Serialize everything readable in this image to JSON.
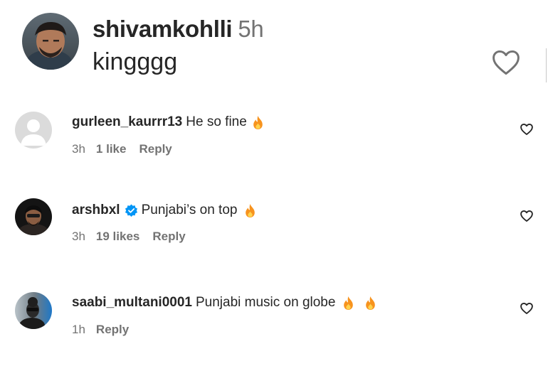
{
  "main_comment": {
    "username": "shivamkohlli",
    "time": "5h",
    "text": "kingggg"
  },
  "replies": [
    {
      "username": "gurleen_kaurrr13",
      "verified": false,
      "text": "He so fine",
      "emoji": [
        "fire-icon"
      ],
      "time": "3h",
      "likes": "1 like",
      "reply_label": "Reply"
    },
    {
      "username": "arshbxl",
      "verified": true,
      "text": "Punjabi’s on top",
      "emoji": [
        "fire-icon"
      ],
      "time": "3h",
      "likes": "19 likes",
      "reply_label": "Reply"
    },
    {
      "username": "saabi_multani0001",
      "verified": false,
      "text": "Punjabi music on globe",
      "emoji": [
        "fire-icon",
        "fire-icon"
      ],
      "time": "1h",
      "likes": "",
      "reply_label": "Reply"
    }
  ],
  "colors": {
    "text_primary": "#262626",
    "text_secondary": "#737373",
    "verified_blue": "#0095f6",
    "fire_orange": "#f7931e"
  }
}
